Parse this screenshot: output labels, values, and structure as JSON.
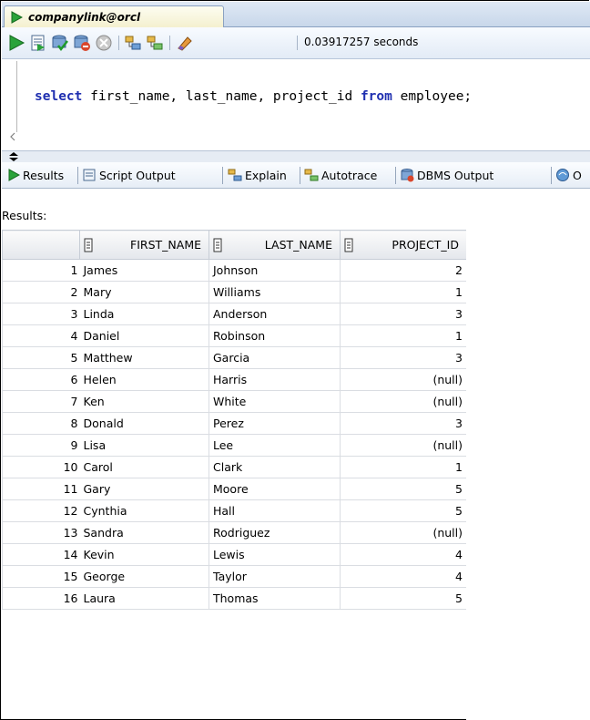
{
  "document_tab": {
    "label": "companylink@orcl"
  },
  "toolbar": {
    "elapsed": "0.03917257 seconds"
  },
  "editor": {
    "kw_select": "select",
    "cols": " first_name, last_name, project_id ",
    "kw_from": "from",
    "table": " employee;"
  },
  "result_tabs": [
    "Results",
    "Script Output",
    "Explain",
    "Autotrace",
    "DBMS Output",
    "O"
  ],
  "results_label": "Results:",
  "grid": {
    "columns": [
      "FIRST_NAME",
      "LAST_NAME",
      "PROJECT_ID"
    ],
    "rows": [
      [
        "1",
        "James",
        "Johnson",
        "2"
      ],
      [
        "2",
        "Mary",
        "Williams",
        "1"
      ],
      [
        "3",
        "Linda",
        "Anderson",
        "3"
      ],
      [
        "4",
        "Daniel",
        "Robinson",
        "1"
      ],
      [
        "5",
        "Matthew",
        "Garcia",
        "3"
      ],
      [
        "6",
        "Helen",
        "Harris",
        "(null)"
      ],
      [
        "7",
        "Ken",
        "White",
        "(null)"
      ],
      [
        "8",
        "Donald",
        "Perez",
        "3"
      ],
      [
        "9",
        "Lisa",
        "Lee",
        "(null)"
      ],
      [
        "10",
        "Carol",
        "Clark",
        "1"
      ],
      [
        "11",
        "Gary",
        "Moore",
        "5"
      ],
      [
        "12",
        "Cynthia",
        "Hall",
        "5"
      ],
      [
        "13",
        "Sandra",
        "Rodriguez",
        "(null)"
      ],
      [
        "14",
        "Kevin",
        "Lewis",
        "4"
      ],
      [
        "15",
        "George",
        "Taylor",
        "4"
      ],
      [
        "16",
        "Laura",
        "Thomas",
        "5"
      ]
    ]
  },
  "colors": {
    "accent_green": "#2aa33a",
    "keyword_blue": "#1f2fb0"
  }
}
